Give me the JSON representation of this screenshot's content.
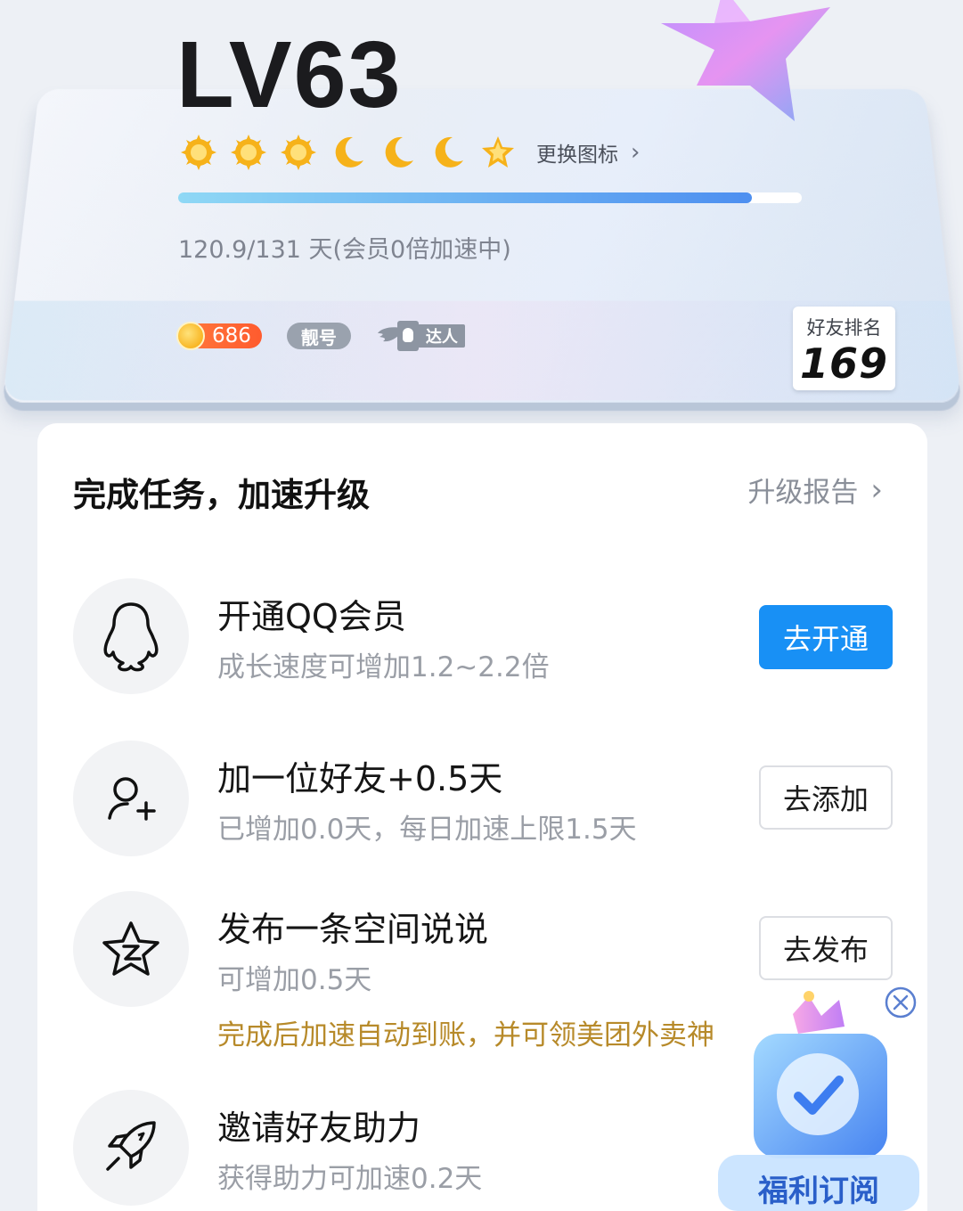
{
  "level": {
    "title": "LV63",
    "change_icon_label": "更换图标",
    "progress_fraction": 0.92,
    "days_text": "120.9/131 天(会员0倍加速中)",
    "icons": [
      "sun-icon",
      "sun-icon",
      "sun-icon",
      "moon-icon",
      "moon-icon",
      "moon-icon",
      "star-icon"
    ]
  },
  "badges": {
    "coin_value": "686",
    "pretty_label": "靓号",
    "master_label": "达人"
  },
  "friend_rank": {
    "label": "好友排名",
    "value": "169"
  },
  "tasks_panel": {
    "title": "完成任务，加速升级",
    "report_label": "升级报告"
  },
  "tasks": [
    {
      "title": "开通QQ会员",
      "subtitle": "成长速度可增加1.2~2.2倍",
      "button": "去开通",
      "icon": "penguin-icon"
    },
    {
      "title": "加一位好友+0.5天",
      "subtitle": "已增加0.0天，每日加速上限1.5天",
      "button": "去添加",
      "icon": "add-friend-icon"
    },
    {
      "title": "发布一条空间说说",
      "subtitle": "可增加0.5天",
      "note": "完成后加速自动到账，并可领美团外卖神",
      "button": "去发布",
      "icon": "qzone-star-icon"
    },
    {
      "title": "邀请好友助力",
      "subtitle": "获得助力可加速0.2天",
      "icon": "rocket-icon"
    }
  ],
  "promo": {
    "label": "福利订阅"
  },
  "colors": {
    "primary": "#1890f5",
    "note": "#b78a2a",
    "background": "#edf0f5"
  }
}
